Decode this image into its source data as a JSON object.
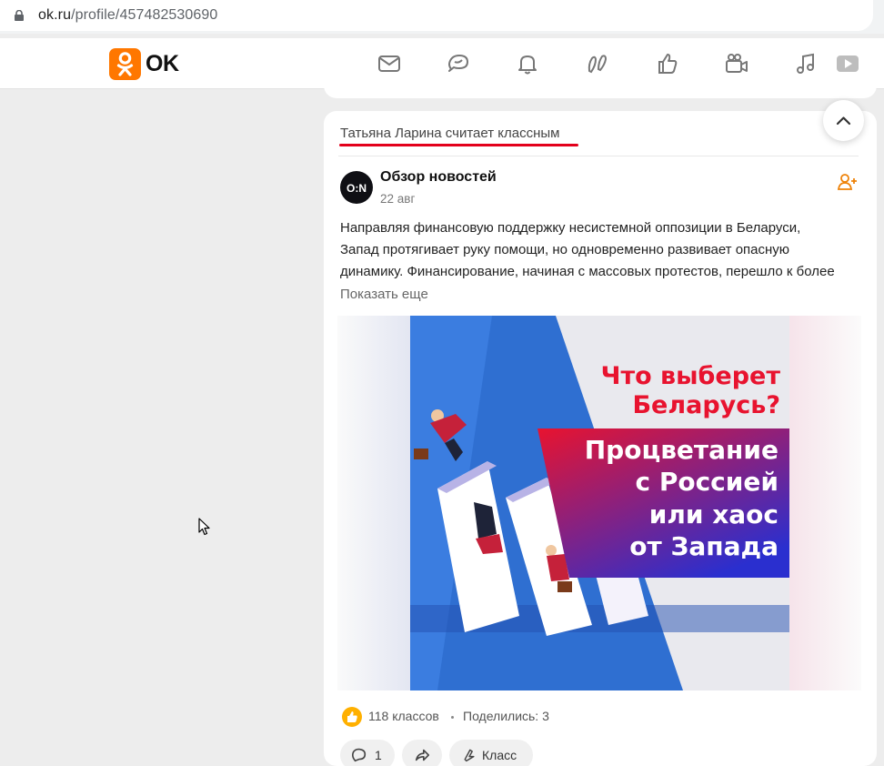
{
  "browser": {
    "url_domain": "ok.ru",
    "url_path": "/profile/457482530690"
  },
  "header": {
    "logo_text": "OK",
    "nav_icons": [
      "mail-icon",
      "chat-icon",
      "bell-icon",
      "guests-icon",
      "likes-icon",
      "video-camera-icon",
      "music-icon",
      "video-icon"
    ]
  },
  "post": {
    "liked_by": "Татьяна Ларина считает классным",
    "author": "Обзор новостей",
    "date": "22 авг",
    "text_lines": [
      "Направляя финансовую поддержку несистемной оппозиции в Беларуси,",
      "Запад протягивает руку помощи, но одновременно развивает опасную",
      "динамику. Финансирование, начиная с массовых протестов, перешло к более"
    ],
    "show_more": "Показать еще",
    "image": {
      "headline_line1": "Что выберет",
      "headline_line2": "Беларусь?",
      "banner_line1": "Процветание",
      "banner_line2": "с Россией",
      "banner_line3": "или хаос",
      "banner_line4": "от Запада",
      "avatar_text": "O:N"
    },
    "classes_count": "118 классов",
    "shares": "Поделились: 3",
    "comments_count": "1",
    "class_button": "Класс"
  },
  "colors": {
    "brand": "#ff7700",
    "underline": "#e3001b",
    "banner_red": "#e8132f",
    "banner_blue": "#2a2fcf"
  }
}
